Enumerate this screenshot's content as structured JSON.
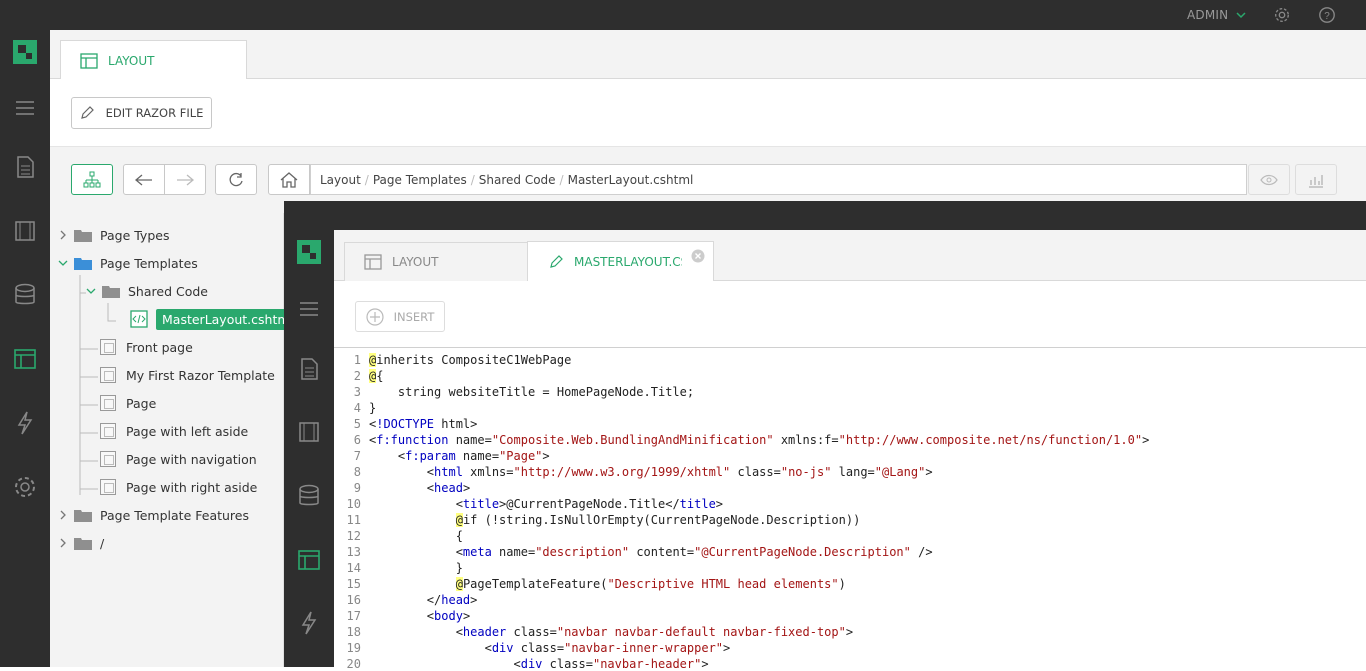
{
  "header": {
    "user": "ADMIN"
  },
  "outer": {
    "tab": "LAYOUT",
    "edit_button": "EDIT RAZOR FILE",
    "breadcrumb": [
      "Layout",
      "Page Templates",
      "Shared Code",
      "MasterLayout.cshtml"
    ]
  },
  "tree": {
    "page_types": "Page Types",
    "page_templates": "Page Templates",
    "shared_code": "Shared Code",
    "master_layout": "MasterLayout.cshtml",
    "templates": [
      "Front page",
      "My First Razor Template",
      "Page",
      "Page with left aside",
      "Page with navigation",
      "Page with right aside"
    ],
    "features": "Page Template Features",
    "root": "/"
  },
  "inner": {
    "tab1": "LAYOUT",
    "tab2": "MASTERLAYOUT.CSH",
    "insert": "INSERT"
  },
  "code": [
    "@inherits CompositeC1WebPage",
    "@{",
    "    string websiteTitle = HomePageNode.Title;",
    "}",
    "<!DOCTYPE html>",
    "<f:function name=\"Composite.Web.BundlingAndMinification\" xmlns:f=\"http://www.composite.net/ns/function/1.0\">",
    "    <f:param name=\"Page\">",
    "        <html xmlns=\"http://www.w3.org/1999/xhtml\" class=\"no-js\" lang=\"@Lang\">",
    "        <head>",
    "            <title>@CurrentPageNode.Title</title>",
    "            @if (!string.IsNullOrEmpty(CurrentPageNode.Description))",
    "            {",
    "            <meta name=\"description\" content=\"@CurrentPageNode.Description\" />",
    "            }",
    "            @PageTemplateFeature(\"Descriptive HTML head elements\")",
    "        </head>",
    "        <body>",
    "            <header class=\"navbar navbar-default navbar-fixed-top\">",
    "                <div class=\"navbar-inner-wrapper\">",
    "                    <div class=\"navbar-header\">"
  ],
  "colors": {
    "accent": "#2aa86d",
    "dark": "#2e2e2e"
  }
}
